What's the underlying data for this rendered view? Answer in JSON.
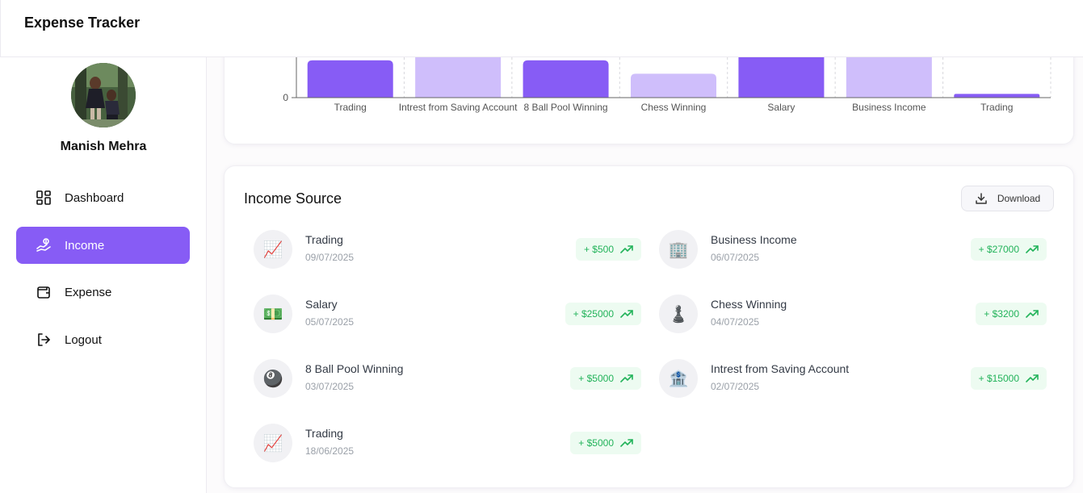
{
  "app": {
    "title": "Expense Tracker"
  },
  "user": {
    "name": "Manish Mehra"
  },
  "nav": [
    {
      "label": "Dashboard",
      "icon": "dashboard-icon",
      "active": false
    },
    {
      "label": "Income",
      "icon": "income-icon",
      "active": true
    },
    {
      "label": "Expense",
      "icon": "wallet-icon",
      "active": false
    },
    {
      "label": "Logout",
      "icon": "logout-icon",
      "active": false
    }
  ],
  "colors": {
    "accent": "#875cf5",
    "accent_light": "#cfbefb",
    "positive": "#22b35a",
    "positive_bg": "#edfbf1"
  },
  "chart_data": {
    "type": "bar",
    "categories": [
      "Trading",
      "Intrest from Saving Account",
      "8 Ball Pool Winning",
      "Chess Winning",
      "Salary",
      "Business Income",
      "Trading"
    ],
    "values": [
      5000,
      15000,
      5000,
      3200,
      25000,
      27000,
      500
    ],
    "y_tick_labels": [
      "0"
    ],
    "ylim": [
      0,
      5400
    ],
    "bar_colors": [
      "#875cf5",
      "#cfbefb",
      "#875cf5",
      "#cfbefb",
      "#875cf5",
      "#cfbefb",
      "#875cf5"
    ],
    "grid": "dashed vertical"
  },
  "income": {
    "title": "Income Source",
    "download_label": "Download",
    "transactions": [
      {
        "title": "Trading",
        "date": "09/07/2025",
        "amount": "+ $500",
        "emoji": "📈"
      },
      {
        "title": "Business Income",
        "date": "06/07/2025",
        "amount": "+ $27000",
        "emoji": "🏢"
      },
      {
        "title": "Salary",
        "date": "05/07/2025",
        "amount": "+ $25000",
        "emoji": "💵"
      },
      {
        "title": "Chess Winning",
        "date": "04/07/2025",
        "amount": "+ $3200",
        "emoji": "♟️"
      },
      {
        "title": "8 Ball Pool Winning",
        "date": "03/07/2025",
        "amount": "+ $5000",
        "emoji": "🎱"
      },
      {
        "title": "Intrest from Saving Account",
        "date": "02/07/2025",
        "amount": "+ $15000",
        "emoji": "🏦"
      },
      {
        "title": "Trading",
        "date": "18/06/2025",
        "amount": "+ $5000",
        "emoji": "📈"
      }
    ]
  }
}
